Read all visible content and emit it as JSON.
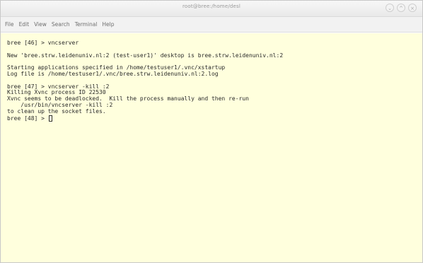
{
  "window": {
    "title": "root@bree:/home/desl",
    "controls": {
      "minimize": "⌄",
      "maximize": "^",
      "close": "×"
    }
  },
  "menu": {
    "items": [
      "File",
      "Edit",
      "View",
      "Search",
      "Terminal",
      "Help"
    ]
  },
  "terminal": {
    "background": "#ffffdd",
    "lines": [
      "bree [46] > vncserver",
      "",
      "New 'bree.strw.leidenuniv.nl:2 (test-user1)' desktop is bree.strw.leidenuniv.nl:2",
      "",
      "Starting applications specified in /home/testuser1/.vnc/xstartup",
      "Log file is /home/testuser1/.vnc/bree.strw.leidenuniv.nl:2.log",
      "",
      "bree [47] > vncserver -kill :2",
      "Killing Xvnc process ID 22530",
      "Xvnc seems to be deadlocked.  Kill the process manually and then re-run",
      "    /usr/bin/vncserver -kill :2",
      "to clean up the socket files.",
      "bree [48] > "
    ]
  }
}
